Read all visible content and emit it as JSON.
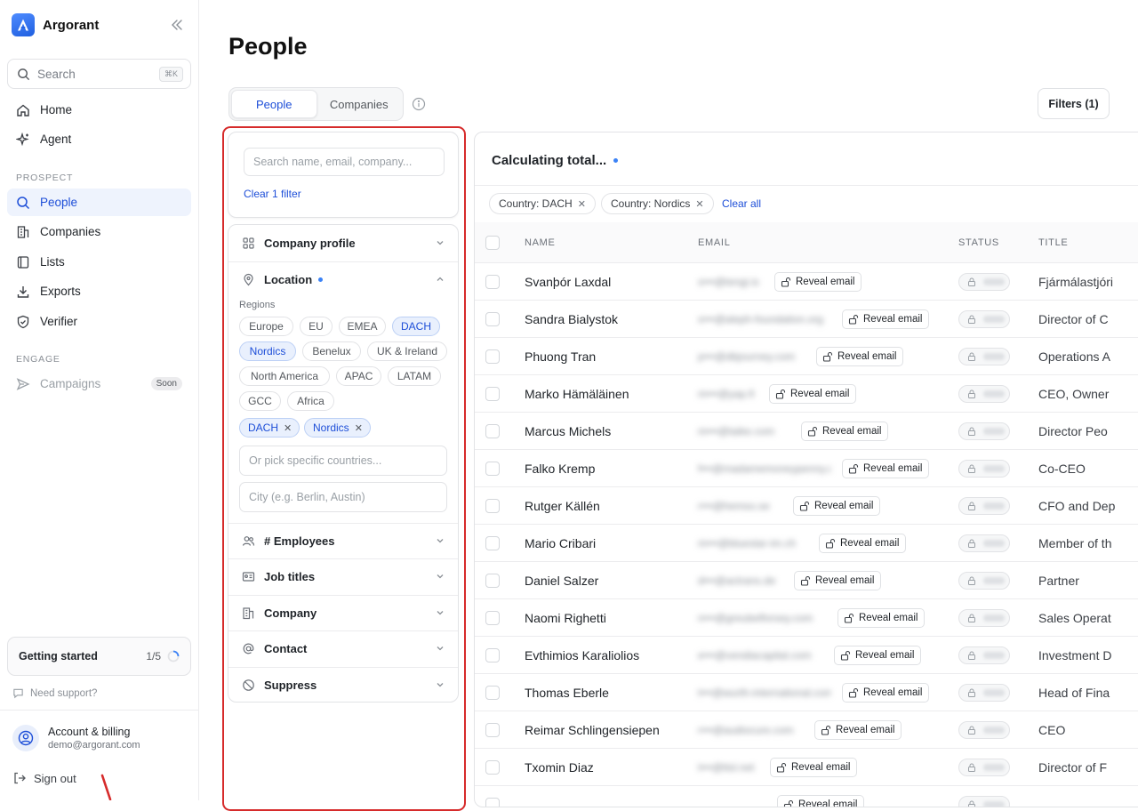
{
  "app": {
    "name": "Argorant"
  },
  "sidebar": {
    "search_placeholder": "Search",
    "search_shortcut": "⌘K",
    "nav": {
      "home": "Home",
      "agent": "Agent"
    },
    "prospect_label": "PROSPECT",
    "prospect": {
      "people": "People",
      "companies": "Companies",
      "lists": "Lists",
      "exports": "Exports",
      "verifier": "Verifier"
    },
    "engage_label": "ENGAGE",
    "engage": {
      "campaigns": "Campaigns",
      "soon": "Soon"
    },
    "getting_started": {
      "label": "Getting started",
      "progress": "1/5"
    },
    "support": "Need support?",
    "account": {
      "title": "Account & billing",
      "email": "demo@argorant.com"
    },
    "sign_out": "Sign out"
  },
  "page": {
    "title": "People",
    "tabs": {
      "people": "People",
      "companies": "Companies"
    },
    "filters_button": "Filters (1)"
  },
  "filters": {
    "search_placeholder": "Search name, email, company...",
    "clear": "Clear 1 filter",
    "company_profile": "Company profile",
    "location": "Location",
    "regions_label": "Regions",
    "regions": {
      "europe": "Europe",
      "eu": "EU",
      "emea": "EMEA",
      "dach": "DACH",
      "nordics": "Nordics",
      "benelux": "Benelux",
      "uk": "UK & Ireland",
      "na": "North America",
      "apac": "APAC",
      "latam": "LATAM",
      "gcc": "GCC",
      "africa": "Africa"
    },
    "selected": {
      "first": "DACH",
      "second": "Nordics"
    },
    "countries_placeholder": "Or pick specific countries...",
    "city_placeholder": "City (e.g. Berlin, Austin)",
    "employees": "# Employees",
    "job_titles": "Job titles",
    "company": "Company",
    "contact": "Contact",
    "suppress": "Suppress"
  },
  "results": {
    "title": "Calculating total...",
    "active_filters": {
      "first": "Country: DACH",
      "second": "Country: Nordics"
    },
    "clear_all": "Clear all",
    "columns": {
      "name": "NAME",
      "email": "EMAIL",
      "status": "STATUS",
      "title": "TITLE"
    },
    "reveal_label": "Reveal email",
    "rows": [
      {
        "name": "Svanþór Laxdal",
        "email": "s•••@tengi.is",
        "title": "Fjármálastjóri"
      },
      {
        "name": "Sandra Bialystok",
        "email": "s•••@aleph-foundation.org",
        "title": "Director of C"
      },
      {
        "name": "Phuong Tran",
        "email": "p•••@dbjourney.com",
        "title": "Operations A"
      },
      {
        "name": "Marko Hämäläinen",
        "email": "m•••@yap.fi",
        "title": "CEO, Owner"
      },
      {
        "name": "Marcus Michels",
        "email": "m•••@taike.com",
        "title": "Director Peo"
      },
      {
        "name": "Falko Kremp",
        "email": "f•••@madamemoneypenny.de",
        "title": "Co-CEO"
      },
      {
        "name": "Rutger Källén",
        "email": "r•••@hemso.se",
        "title": "CFO and Dep"
      },
      {
        "name": "Mario Cribari",
        "email": "m•••@bluestar-im.ch",
        "title": "Member of th"
      },
      {
        "name": "Daniel Salzer",
        "email": "d•••@actrans.de",
        "title": "Partner"
      },
      {
        "name": "Naomi Righetti",
        "email": "n•••@greubelforsey.com",
        "title": "Sales Operat"
      },
      {
        "name": "Evthimios Karaliolios",
        "email": "e•••@vendiacapital.com",
        "title": "Investment D"
      },
      {
        "name": "Thomas Eberle",
        "email": "t•••@wurth-international.com",
        "title": "Head of Fina"
      },
      {
        "name": "Reimar Schlingensiepen",
        "email": "r•••@audiocure.com",
        "title": "CEO"
      },
      {
        "name": "Txomin Diaz",
        "email": "t•••@ttsl.net",
        "title": "Director of F"
      },
      {
        "name": "",
        "email": "",
        "title": ""
      }
    ]
  }
}
